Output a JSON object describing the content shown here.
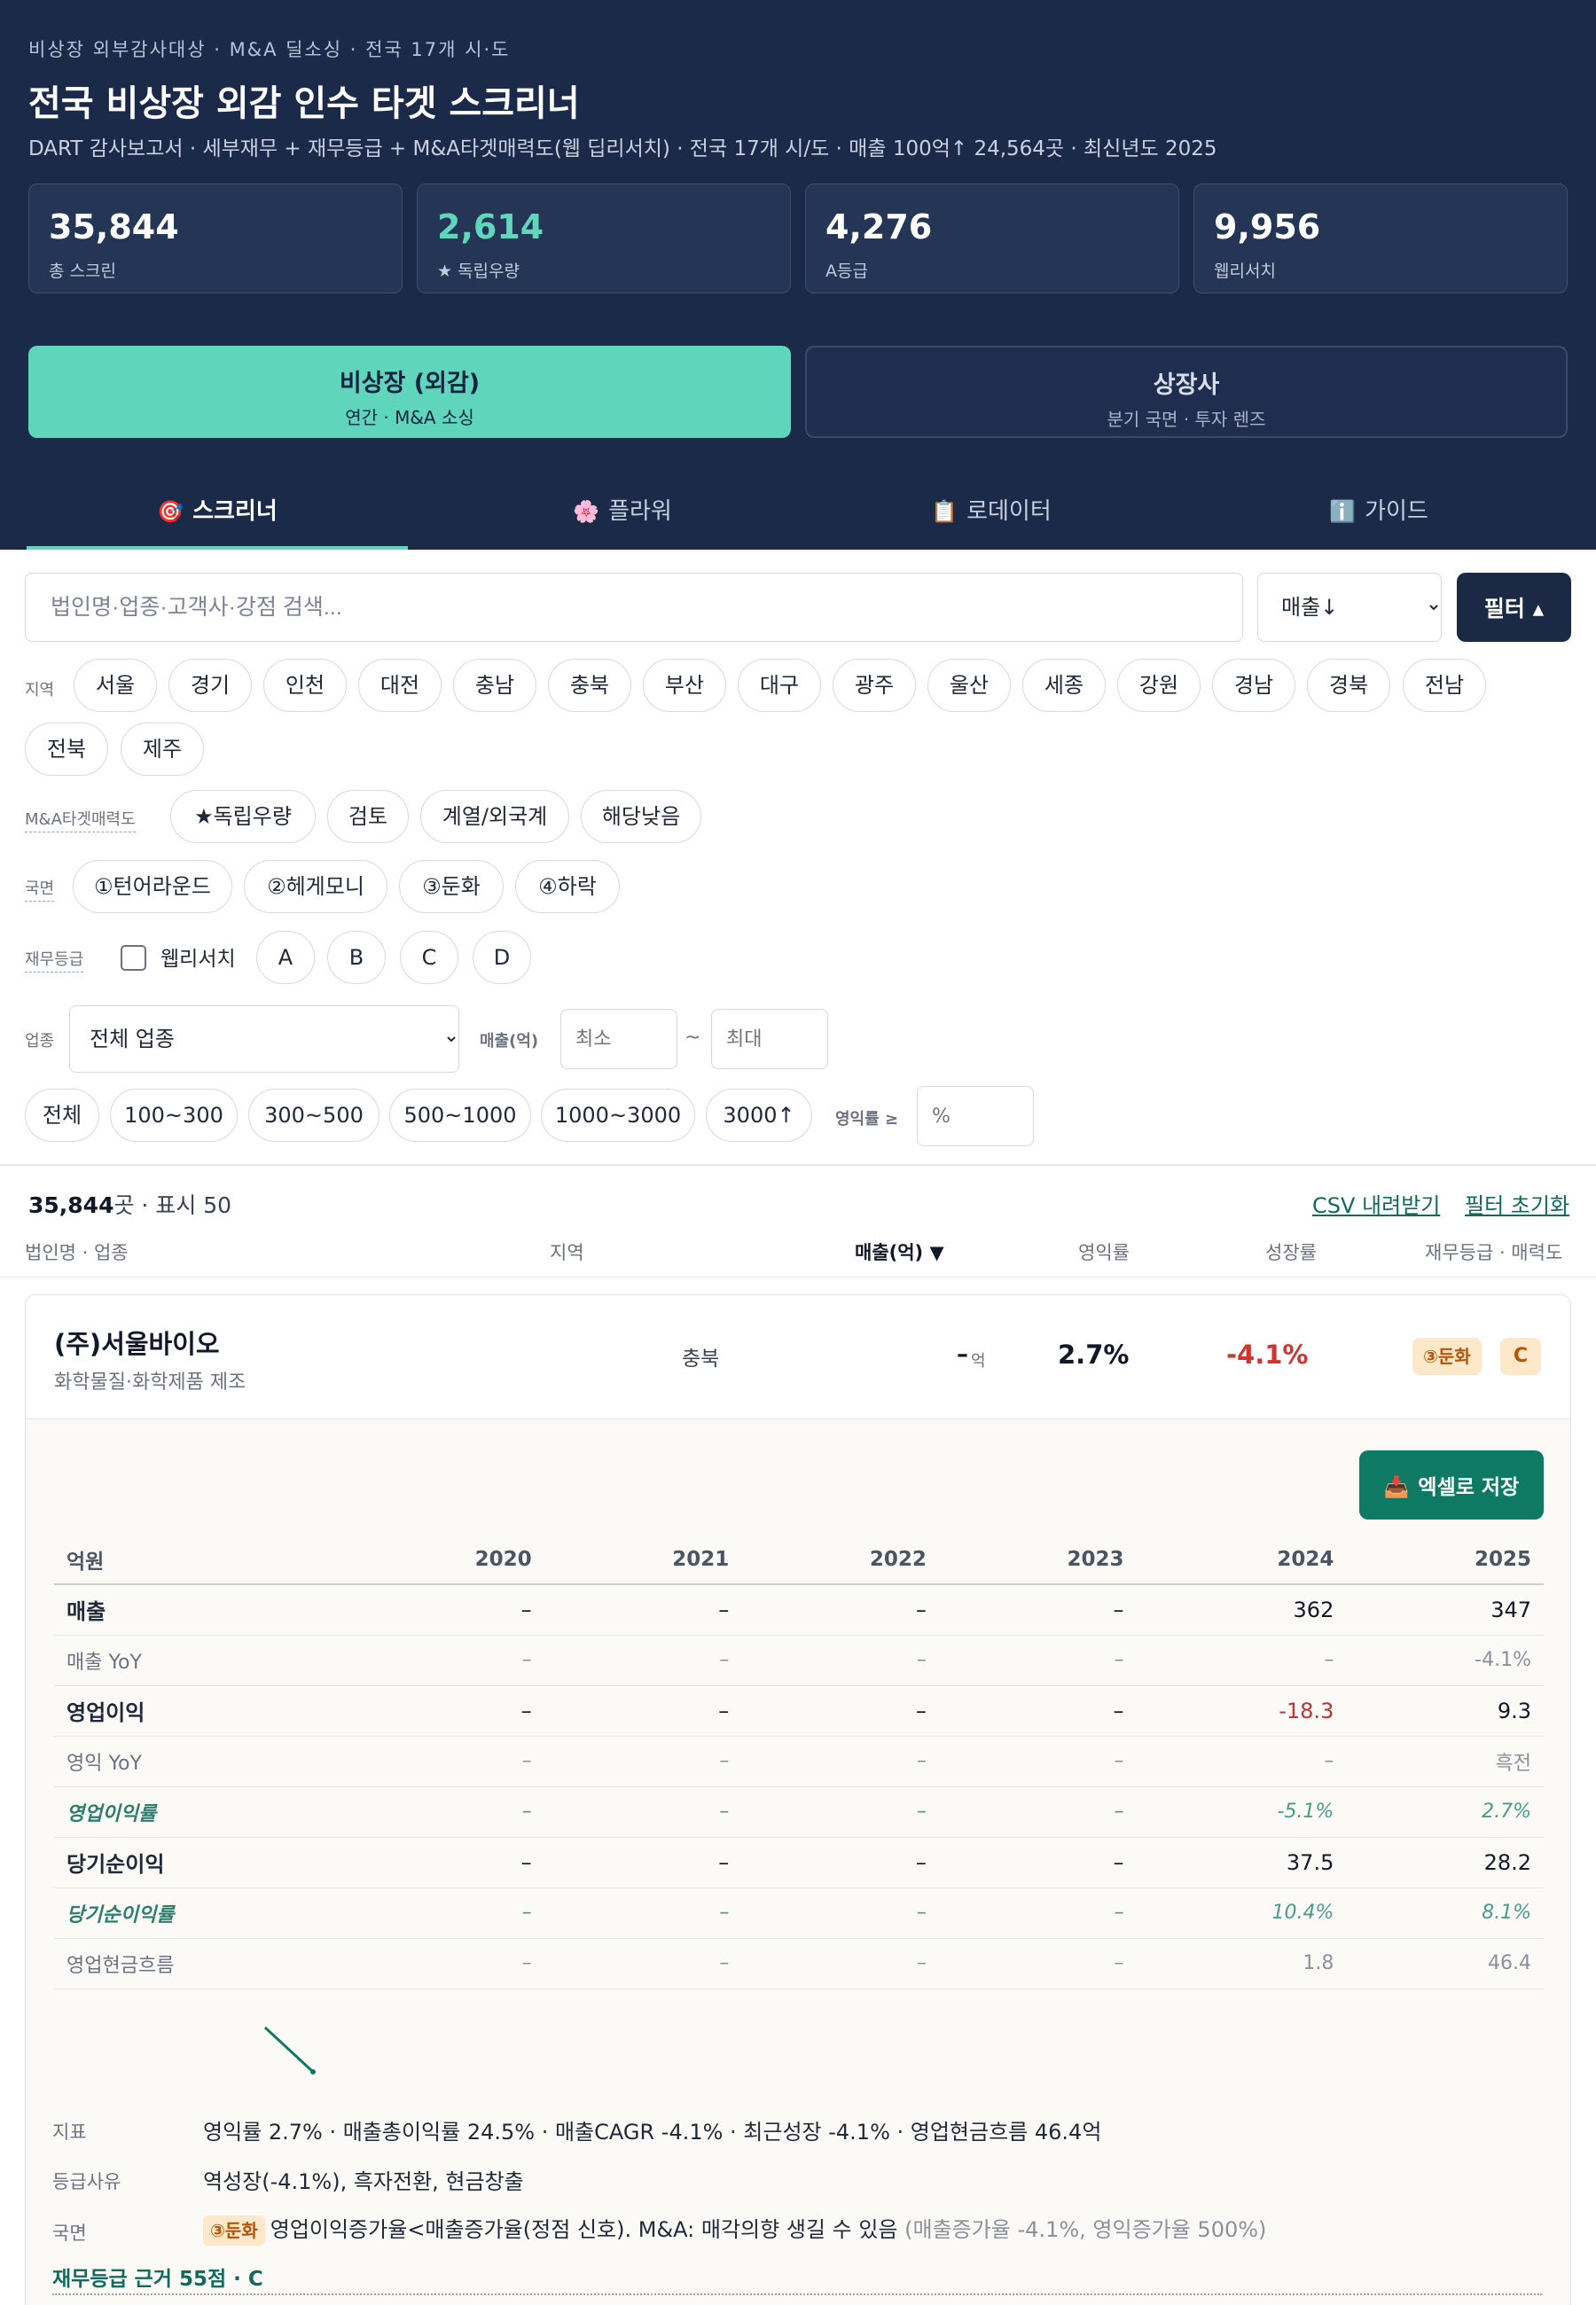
{
  "header": {
    "eyebrow": "비상장 외부감사대상 · M&A 딜소싱 · 전국 17개 시·도",
    "title": "전국 비상장 외감 인수 타겟 스크리너",
    "subtitle": "DART 감사보고서 · 세부재무 + 재무등급 + M&A타겟매력도(웹 딥리서치) · 전국 17개 시/도 · 매출 100억↑ 24,564곳 · 최신년도 2025"
  },
  "stats": [
    {
      "value": "35,844",
      "label": "총 스크린",
      "highlight": false
    },
    {
      "value": "2,614",
      "label": "★ 독립우량",
      "highlight": true,
      "color": "#5fd7ba"
    },
    {
      "value": "4,276",
      "label": "A등급",
      "highlight": false
    },
    {
      "value": "9,956",
      "label": "웹리서치",
      "highlight": false
    }
  ],
  "modes": [
    {
      "title": "비상장 (외감)",
      "sub": "연간 · M&A 소싱",
      "active": true
    },
    {
      "title": "상장사",
      "sub": "분기 국면 · 투자 렌즈",
      "active": false
    }
  ],
  "tabs": [
    {
      "icon": "🎯",
      "icon_name": "target-icon",
      "label": "스크리너",
      "active": true
    },
    {
      "icon": "🌸",
      "icon_name": "flower-icon",
      "label": "플라워",
      "active": false
    },
    {
      "icon": "📋",
      "icon_name": "clipboard-icon",
      "label": "로데이터",
      "active": false
    },
    {
      "icon": "ℹ️",
      "icon_name": "info-icon",
      "label": "가이드",
      "active": false
    }
  ],
  "search": {
    "placeholder": "법인명·업종·고객사·강점 검색..."
  },
  "sort": {
    "selected": "매출↓"
  },
  "filter_button": "필터 ▴",
  "filters": {
    "region_label": "지역",
    "regions": [
      "서울",
      "경기",
      "인천",
      "대전",
      "충남",
      "충북",
      "부산",
      "대구",
      "광주",
      "울산",
      "세종",
      "강원",
      "경남",
      "경북",
      "전남",
      "전북",
      "제주"
    ],
    "ma_label": "M&A타겟매력도",
    "ma": [
      "★독립우량",
      "검토",
      "계열/외국계",
      "해당낮음"
    ],
    "phase_label": "국면",
    "phases": [
      "①턴어라운드",
      "②헤게모니",
      "③둔화",
      "④하락"
    ],
    "grade_label": "재무등급",
    "web_research": "웹리서치",
    "grades": [
      "A",
      "B",
      "C",
      "D"
    ],
    "industry_label": "업종",
    "industry_selected": "전체 업종",
    "sales_label": "매출(억)",
    "sales_min_placeholder": "최소",
    "sales_max_placeholder": "최대",
    "tilde": "~",
    "sales_ranges": [
      "전체",
      "100~300",
      "300~500",
      "500~1000",
      "1000~3000",
      "3000↑"
    ],
    "margin_label": "영익률 ≥",
    "margin_placeholder": "%"
  },
  "results": {
    "count": "35,844",
    "count_suffix": "곳 · 표시 50",
    "csv_link": "CSV 내려받기",
    "reset_link": "필터 초기화",
    "columns": {
      "name": "법인명 · 업종",
      "region": "지역",
      "sales": "매출(억) ▼",
      "margin": "영익률",
      "growth": "성장률",
      "grade": "재무등급 · 매력도"
    }
  },
  "company": {
    "name": "(주)서울바이오",
    "industry": "화학물질·화학제품 제조",
    "region": "충북",
    "sales": "–",
    "sales_unit": "억",
    "margin": "2.7%",
    "growth": "-4.1%",
    "phase_badge": "③둔화",
    "grade_badge": "C",
    "excel_button": "엑셀로 저장",
    "excel_icon": "📥",
    "fin_table": {
      "unit": "억원",
      "years": [
        "2020",
        "2021",
        "2022",
        "2023",
        "2024",
        "2025"
      ],
      "rows": [
        {
          "label": "매출",
          "kind": "main",
          "values": [
            "–",
            "–",
            "–",
            "–",
            "362",
            "347"
          ]
        },
        {
          "label": "매출 YoY",
          "kind": "sub",
          "values": [
            "–",
            "–",
            "–",
            "–",
            "–",
            "-4.1%"
          ]
        },
        {
          "label": "영업이익",
          "kind": "main",
          "values": [
            "–",
            "–",
            "–",
            "–",
            "-18.3",
            "9.3"
          ]
        },
        {
          "label": "영익 YoY",
          "kind": "sub",
          "values": [
            "–",
            "–",
            "–",
            "–",
            "–",
            "흑전"
          ]
        },
        {
          "label": "영업이익률",
          "kind": "ratio",
          "values": [
            "–",
            "–",
            "–",
            "–",
            "-5.1%",
            "2.7%"
          ]
        },
        {
          "label": "당기순이익",
          "kind": "main",
          "values": [
            "–",
            "–",
            "–",
            "–",
            "37.5",
            "28.2"
          ]
        },
        {
          "label": "당기순이익률",
          "kind": "ratio",
          "values": [
            "–",
            "–",
            "–",
            "–",
            "10.4%",
            "8.1%"
          ]
        },
        {
          "label": "영업현금흐름",
          "kind": "sub",
          "values": [
            "–",
            "–",
            "–",
            "–",
            "1.8",
            "46.4"
          ]
        }
      ]
    },
    "indicators_label": "지표",
    "indicators": "영익률 2.7% · 매출총이익률 24.5% · 매출CAGR -4.1% · 최근성장 -4.1% · 영업현금흐름 46.4억",
    "grade_reason_label": "등급사유",
    "grade_reason": "역성장(-4.1%), 흑자전환, 현금창출",
    "phase_label": "국면",
    "phase_tag": "③둔화",
    "phase_text": "영업이익증가율<매출증가율(정점 신호). M&A: 매각의향 생길 수 있음",
    "phase_note": "(매출증가율 -4.1%, 영익증가율 500%)",
    "basis": "재무등급 근거 55점 · C"
  },
  "colors": {
    "navy": "#1c2a49",
    "teal": "#5fd6bc",
    "excel_green": "#0f7a63",
    "negative": "#d0342c"
  }
}
